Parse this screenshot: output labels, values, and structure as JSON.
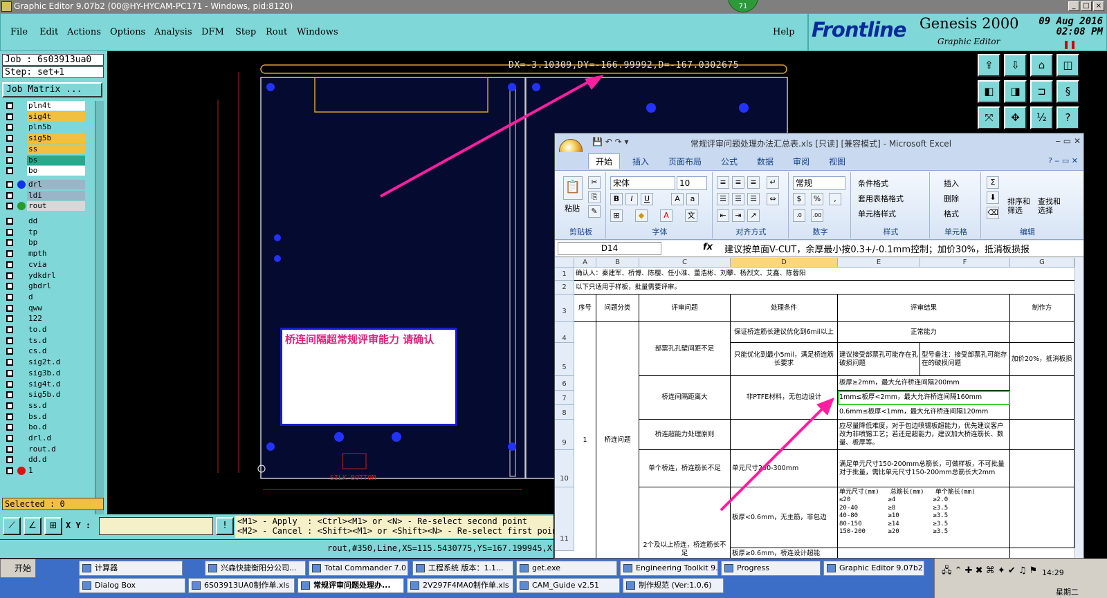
{
  "window": {
    "title": "Graphic Editor 9.07b2 (00@HY-HYCAM-PC171 - Windows, pid:8120)",
    "badge": "71",
    "controls": [
      "_",
      "□",
      "×"
    ]
  },
  "menu": {
    "items": [
      "File",
      "Edit",
      "Actions",
      "Options",
      "Analysis",
      "DFM",
      "Step",
      "Rout",
      "Windows"
    ],
    "help": "Help"
  },
  "logo": {
    "brand": "Frontline",
    "product": "Genesis 2000",
    "subtitle": "Graphic Editor",
    "date": "09 Aug 2016",
    "time": "02:08 PM"
  },
  "left": {
    "job": "Job : 6s03913ua0",
    "step": "Step: set+1",
    "job_matrix": "Job Matrix ...",
    "selected": "Selected : 0",
    "layers": [
      {
        "name": "pln4t",
        "color": "#ffffff"
      },
      {
        "name": "sig4t",
        "color": "#f0c040"
      },
      {
        "name": "pln5b",
        "color": "#7fd7d7"
      },
      {
        "name": "sig5b",
        "color": "#f0c040"
      },
      {
        "name": "ss",
        "color": "#f0c040"
      },
      {
        "name": "bs",
        "color": "#2aa88a"
      },
      {
        "name": "bo",
        "color": "#ffffff"
      },
      {
        "name": "drl",
        "color": "#9bb5c8",
        "dot": "#1133ee"
      },
      {
        "name": "ldi",
        "color": "#9bb5c8"
      },
      {
        "name": "rout",
        "color": "#d8d8d8",
        "dot": "#2a9a2a"
      },
      {
        "name": "dd",
        "color": "#7fd7d7"
      },
      {
        "name": "tp",
        "color": "#7fd7d7"
      },
      {
        "name": "bp",
        "color": "#7fd7d7"
      },
      {
        "name": "mpth",
        "color": "#7fd7d7"
      },
      {
        "name": "cvia",
        "color": "#7fd7d7"
      },
      {
        "name": "ydkdrl",
        "color": "#7fd7d7"
      },
      {
        "name": "gbdrl",
        "color": "#7fd7d7"
      },
      {
        "name": "d",
        "color": "#7fd7d7"
      },
      {
        "name": "qww",
        "color": "#7fd7d7"
      },
      {
        "name": "122",
        "color": "#7fd7d7"
      },
      {
        "name": "to.d",
        "color": "#7fd7d7"
      },
      {
        "name": "ts.d",
        "color": "#7fd7d7"
      },
      {
        "name": "cs.d",
        "color": "#7fd7d7"
      },
      {
        "name": "sig2t.d",
        "color": "#7fd7d7"
      },
      {
        "name": "sig3b.d",
        "color": "#7fd7d7"
      },
      {
        "name": "sig4t.d",
        "color": "#7fd7d7"
      },
      {
        "name": "sig5b.d",
        "color": "#7fd7d7"
      },
      {
        "name": "ss.d",
        "color": "#7fd7d7"
      },
      {
        "name": "bs.d",
        "color": "#7fd7d7"
      },
      {
        "name": "bo.d",
        "color": "#7fd7d7"
      },
      {
        "name": "drl.d",
        "color": "#7fd7d7"
      },
      {
        "name": "rout.d",
        "color": "#7fd7d7"
      },
      {
        "name": "dd.d",
        "color": "#7fd7d7"
      },
      {
        "name": "1",
        "color": "#7fd7d7",
        "dot": "#dd1111"
      }
    ]
  },
  "canvas": {
    "measure": "DX=-3.10309,DY=-166.99992,D=-167.0302675",
    "alert": "桥连间隔超常规评审能力 请确认",
    "silk_label": "SILK-BOTTOM"
  },
  "bottom": {
    "xy_label": "X Y :",
    "xy_value": "",
    "hint": "<M1> - Apply  : <Ctrl><M1> or <N> - Re-select second point\n<M2> - Cancel : <Shift><M1> or <Shift><N> - Re-select first point",
    "coord": "rout,#350,Line,XS=115.5430775,YS=167.199945,X"
  },
  "excel": {
    "title": "常规评审问题处理办法汇总表.xls [只读] [兼容模式] - Microsoft Excel",
    "tabs": [
      "开始",
      "插入",
      "页面布局",
      "公式",
      "数据",
      "审阅",
      "视图"
    ],
    "ribbon": {
      "paste": "粘贴",
      "clipboard": "剪贴板",
      "font_name": "宋体",
      "font_size": "10",
      "font_group": "字体",
      "align_group": "对齐方式",
      "number_format": "常规",
      "number_group": "数字",
      "cond_format": "条件格式",
      "table_format": "套用表格格式",
      "cell_style": "单元格样式",
      "style_group": "样式",
      "insert": "插入",
      "delete": "删除",
      "format": "格式",
      "cells_group": "单元格",
      "sort": "排序和\n筛选",
      "find": "查找和\n选择",
      "edit_group": "编辑"
    },
    "name_box": "D14",
    "fx": "fx",
    "formula": "建议按单面V-CUT，余厚最小按0.3+/-0.1mm控制；加价30%，抵消板损报",
    "columns": [
      "A",
      "B",
      "C",
      "D",
      "E",
      "F",
      "G"
    ],
    "rows": [
      "1",
      "2",
      "3",
      "4",
      "5",
      "6",
      "7",
      "8",
      "9",
      "10",
      "11"
    ],
    "cells": {
      "r1": "确认人：秦建军、桥博、陈樱、任小淮、董浩彬、刘攀、杨烈文、艾鑫、陈蓉阳",
      "r2": "以下只适用于样板，批量需要评审。",
      "h_a": "序号",
      "h_b": "问题分类",
      "h_c": "评审问题",
      "h_d": "处理条件",
      "h_e": "评审结果",
      "h_g": "制作方",
      "c4": "部票孔孔壁间距不足",
      "d4": "保证桥连筋长建议优化到6mil以上",
      "e4": "正常能力",
      "d5": "只能优化到最小5mil，满足桥连筋长要求",
      "e5": "建议接受部票孔可能存在孔破损问题",
      "f5": "型号备注：接受部票孔可能存在的破损问题",
      "g5": "加价20%，抵消板损",
      "c6": "桥连间隔距离大",
      "d6": "非PTFE材料，无包边设计",
      "e6": "板厚≥2mm，最大允许桥连间隔200mm",
      "e7": "1mm≤板厚<2mm，最大允许桥连间隔160mm",
      "e8": "0.6mm≤板厚<1mm，最大允许桥连间隔120mm",
      "c9": "桥连超能力处理原则",
      "e9": "应尽量降低难度，对于包边喷锡板超能力，优先建议客户改为非喷锡工艺；若还是超能力，建议加大桥连筋长、数量、板厚等。",
      "a10": "1",
      "b10": "桥连问题",
      "c10": "单个桥连，桥连筋长不足",
      "d10": "单元尺寸200-300mm",
      "e10": "满足单元尺寸150-200mm总筋长，可做样板，不可批量\n对于批量，需比单元尺寸150-200mm总筋长大2mm",
      "c11": "2个及以上桥连，桥连筋长不足",
      "d11": "板厚<0.6mm，无主筋，非包边",
      "e11_head": "单元尺寸(mm)   总筋长(mm)   单个筋长(mm)",
      "e11_rows": "≤20          ≥4          ≥2.0\n20-40        ≥8          ≥3.5\n40-80        ≥10         ≥3.5\n80-150       ≥14         ≥3.5\n150-200      ≥20         ≥3.5",
      "d12": "板厚≥0.6mm，桥连设计超能"
    }
  },
  "taskbar": {
    "start": "开始",
    "row1": [
      "计算器",
      "兴森快捷衡阳分公司...",
      "Total Commander 7.0 ...",
      "工程系统  版本：1.1...",
      "get.exe",
      "Engineering Toolkit 9.0...",
      "Progress",
      "Graphic Editor 9.07b2 ..."
    ],
    "row2": [
      "Dialog Box",
      "6S03913UA0制作单.xls",
      "常规评审问题处理办...",
      "2V297F4MA0制作单.xls",
      "CAM_Guide v2.51",
      "制作规范 (Ver:1.0.6)"
    ],
    "time": "14:29",
    "weekday": "星期二"
  }
}
